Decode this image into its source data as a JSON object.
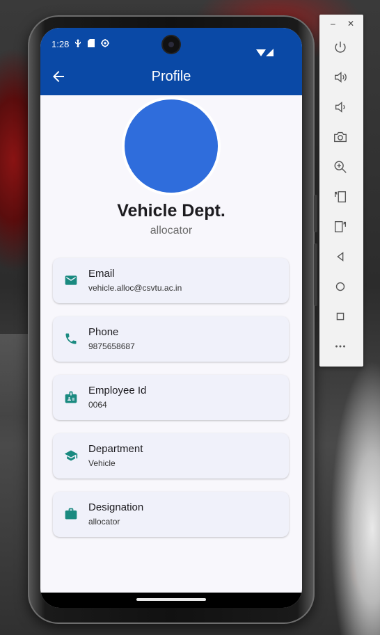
{
  "status_bar": {
    "time": "1:28"
  },
  "app_bar": {
    "title": "Profile"
  },
  "profile": {
    "name": "Vehicle Dept.",
    "role": "allocator",
    "avatar_color": "#2f6ddc"
  },
  "details": [
    {
      "icon": "email-icon",
      "label": "Email",
      "value": "vehicle.alloc@csvtu.ac.in"
    },
    {
      "icon": "phone-icon",
      "label": "Phone",
      "value": "9875658687"
    },
    {
      "icon": "badge-icon",
      "label": "Employee Id",
      "value": "0064"
    },
    {
      "icon": "school-icon",
      "label": "Department",
      "value": "Vehicle"
    },
    {
      "icon": "briefcase-icon",
      "label": "Designation",
      "value": "allocator"
    }
  ],
  "colors": {
    "app_bar": "#0a49a6",
    "icon_teal": "#1a8a80",
    "card_bg": "#f0f1fa"
  },
  "emulator_toolbar": {
    "buttons": [
      "power-icon",
      "volume-up-icon",
      "volume-down-icon",
      "camera-icon",
      "zoom-in-icon",
      "rotate-left-icon",
      "rotate-right-icon",
      "back-icon",
      "home-icon",
      "overview-icon",
      "more-icon"
    ]
  }
}
